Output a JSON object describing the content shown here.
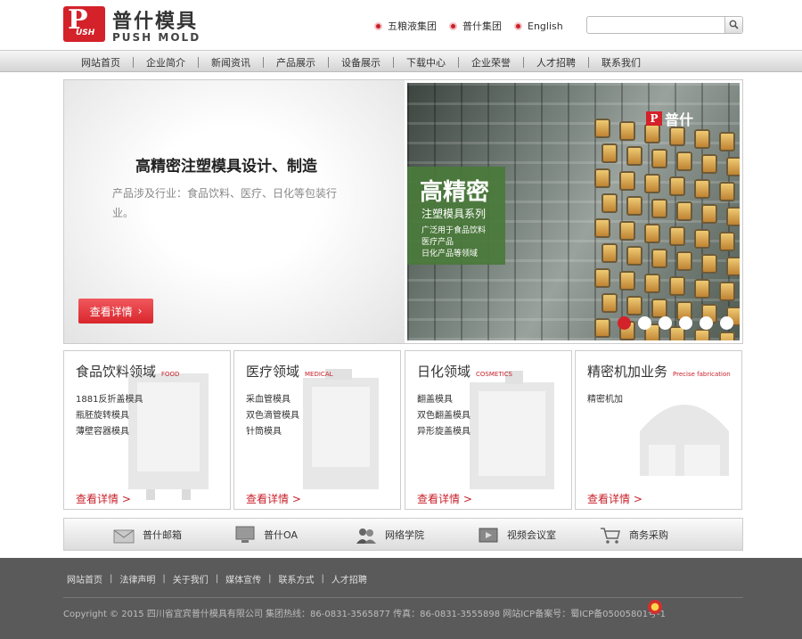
{
  "header": {
    "logo_p": "P",
    "logo_ush": "USH",
    "brand_cn": "普什模具",
    "brand_en": "PUSH MOLD",
    "top_links": [
      {
        "label": "五粮液集团",
        "icon": "bullet-dot-icon"
      },
      {
        "label": "普什集团",
        "icon": "bullet-dot-icon"
      },
      {
        "label": "English",
        "icon": "bullet-dot-icon"
      }
    ],
    "search": {
      "value": "",
      "placeholder": "",
      "icon": "search-icon"
    }
  },
  "nav": {
    "items": [
      "网站首页",
      "企业简介",
      "新闻资讯",
      "产品展示",
      "设备展示",
      "下载中心",
      "企业荣誉",
      "人才招聘",
      "联系我们"
    ]
  },
  "banner": {
    "title": "高精密注塑模具设计、制造",
    "desc": "产品涉及行业：食品饮料、医疗、日化等包装行业。",
    "button": "查看详情",
    "photo": {
      "logo_text": "普什",
      "headline": "高精密",
      "subhead": "注塑模具系列",
      "lines": [
        "广泛用于食品饮料",
        "医疗产品",
        "日化产品等领域"
      ]
    },
    "slides": 6,
    "active_slide": 1
  },
  "cards": [
    {
      "title": "食品饮料领域",
      "en": "FOOD",
      "items": [
        "1881反折盖模具",
        "瓶胚旋转模具",
        "薄壁容器模具"
      ],
      "more": "查看详情 >"
    },
    {
      "title": "医疗领域",
      "en": "MEDICAL",
      "items": [
        "采血管模具",
        "双色滴管模具",
        "针筒模具"
      ],
      "more": "查看详情 >"
    },
    {
      "title": "日化领域",
      "en": "COSMETICS",
      "items": [
        "翻盖模具",
        "双色翻盖模具",
        "异形旋盖模具"
      ],
      "more": "查看详情 >"
    },
    {
      "title": "精密机加业务",
      "en": "Precise fabrication",
      "items": [
        "精密机加"
      ],
      "more": "查看详情 >"
    }
  ],
  "quick_links": [
    {
      "label": "普什邮箱",
      "icon": "mail-icon"
    },
    {
      "label": "普什OA",
      "icon": "monitor-icon"
    },
    {
      "label": "网络学院",
      "icon": "users-icon"
    },
    {
      "label": "视频会议室",
      "icon": "video-icon"
    },
    {
      "label": "商务采购",
      "icon": "cart-icon"
    }
  ],
  "footer": {
    "links": [
      "网站首页",
      "法律声明",
      "关于我们",
      "媒体宣传",
      "联系方式",
      "人才招聘"
    ],
    "copyright": "Copyright © 2015 四川省宜宾普什模具有限公司 集团热线：86-0831-3565877 传真：86-0831-3555898 网站ICP备案号：蜀ICP备05005801号-1"
  },
  "colors": {
    "accent": "#d3222a",
    "green_panel": "#4a7a3a",
    "footer_bg": "#5a5a5a"
  }
}
